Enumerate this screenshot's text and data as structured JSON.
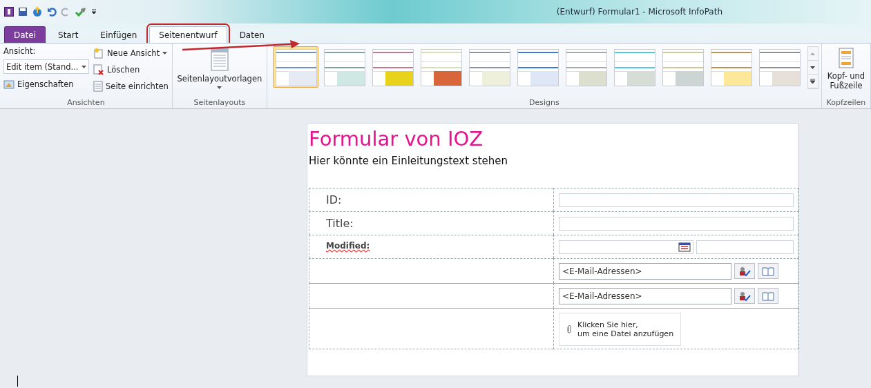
{
  "window": {
    "title": "(Entwurf) Formular1  -  Microsoft InfoPath"
  },
  "tabs": [
    {
      "label": "Datei",
      "kind": "file",
      "selected": false,
      "highlighted": false
    },
    {
      "label": "Start",
      "kind": "tab",
      "selected": false,
      "highlighted": false
    },
    {
      "label": "Einfügen",
      "kind": "tab",
      "selected": false,
      "highlighted": false
    },
    {
      "label": "Seitenentwurf",
      "kind": "tab",
      "selected": true,
      "highlighted": true
    },
    {
      "label": "Daten",
      "kind": "tab",
      "selected": false,
      "highlighted": false
    }
  ],
  "annotation_arrow": true,
  "ribbon": {
    "views": {
      "label": "Ansicht:",
      "view_select": "Edit item (Stand...",
      "properties": "Eigenschaften",
      "new_view": "Neue Ansicht",
      "delete": "Löschen",
      "page_setup": "Seite einrichten",
      "group": "Ansichten"
    },
    "layouts": {
      "button": "Seitenlayoutvorlagen",
      "group": "Seitenlayouts"
    },
    "designs": {
      "group": "Designs",
      "items": [
        {
          "color": "#6f8fc8",
          "swatch": {
            "color": "#e6ebf3"
          },
          "selected": true
        },
        {
          "color": "#7fa3a0",
          "swatch": {
            "color": "#cfe8e4"
          },
          "selected": false
        },
        {
          "color": "#c0788f",
          "swatch": {
            "color": "#e8d21a"
          },
          "selected": false
        },
        {
          "color": "#d9ddb8",
          "swatch": {
            "color": "#d9663a"
          },
          "selected": false
        },
        {
          "color": "#8c93a8",
          "swatch": {
            "color": "#eef0dc"
          },
          "selected": false
        },
        {
          "color": "#3a78e6",
          "swatch": {
            "color": "#dfe6f5"
          },
          "selected": false
        },
        {
          "color": "#a8a8b0",
          "swatch": {
            "color": "#dcdfcd"
          },
          "selected": false
        },
        {
          "color": "#52c6e6",
          "swatch": {
            "color": "#d6ddd6"
          },
          "selected": false
        },
        {
          "color": "#c8c89a",
          "swatch": {
            "color": "#ccd4d4"
          },
          "selected": false
        },
        {
          "color": "#c0905a",
          "swatch": {
            "color": "#fde89a"
          },
          "selected": false
        },
        {
          "color": "#909090",
          "swatch": {
            "color": "#e6e0d8"
          },
          "selected": false
        }
      ]
    },
    "header": {
      "button": "Kopf- und Fußzeile",
      "group": "Kopfzeilen"
    }
  },
  "form": {
    "title": "Formular von IOZ",
    "intro": "Hier könnte ein Einleitungstext stehen",
    "rows": [
      {
        "kind": "text",
        "label": "ID:"
      },
      {
        "kind": "text",
        "label": "Title:"
      },
      {
        "kind": "date",
        "label": "Modified:"
      },
      {
        "kind": "person",
        "placeholder": "<E-Mail-Adressen>"
      },
      {
        "kind": "person",
        "placeholder": "<E-Mail-Adressen>"
      },
      {
        "kind": "attachment",
        "text": "Klicken Sie hier,\num eine Datei anzufügen"
      }
    ]
  }
}
